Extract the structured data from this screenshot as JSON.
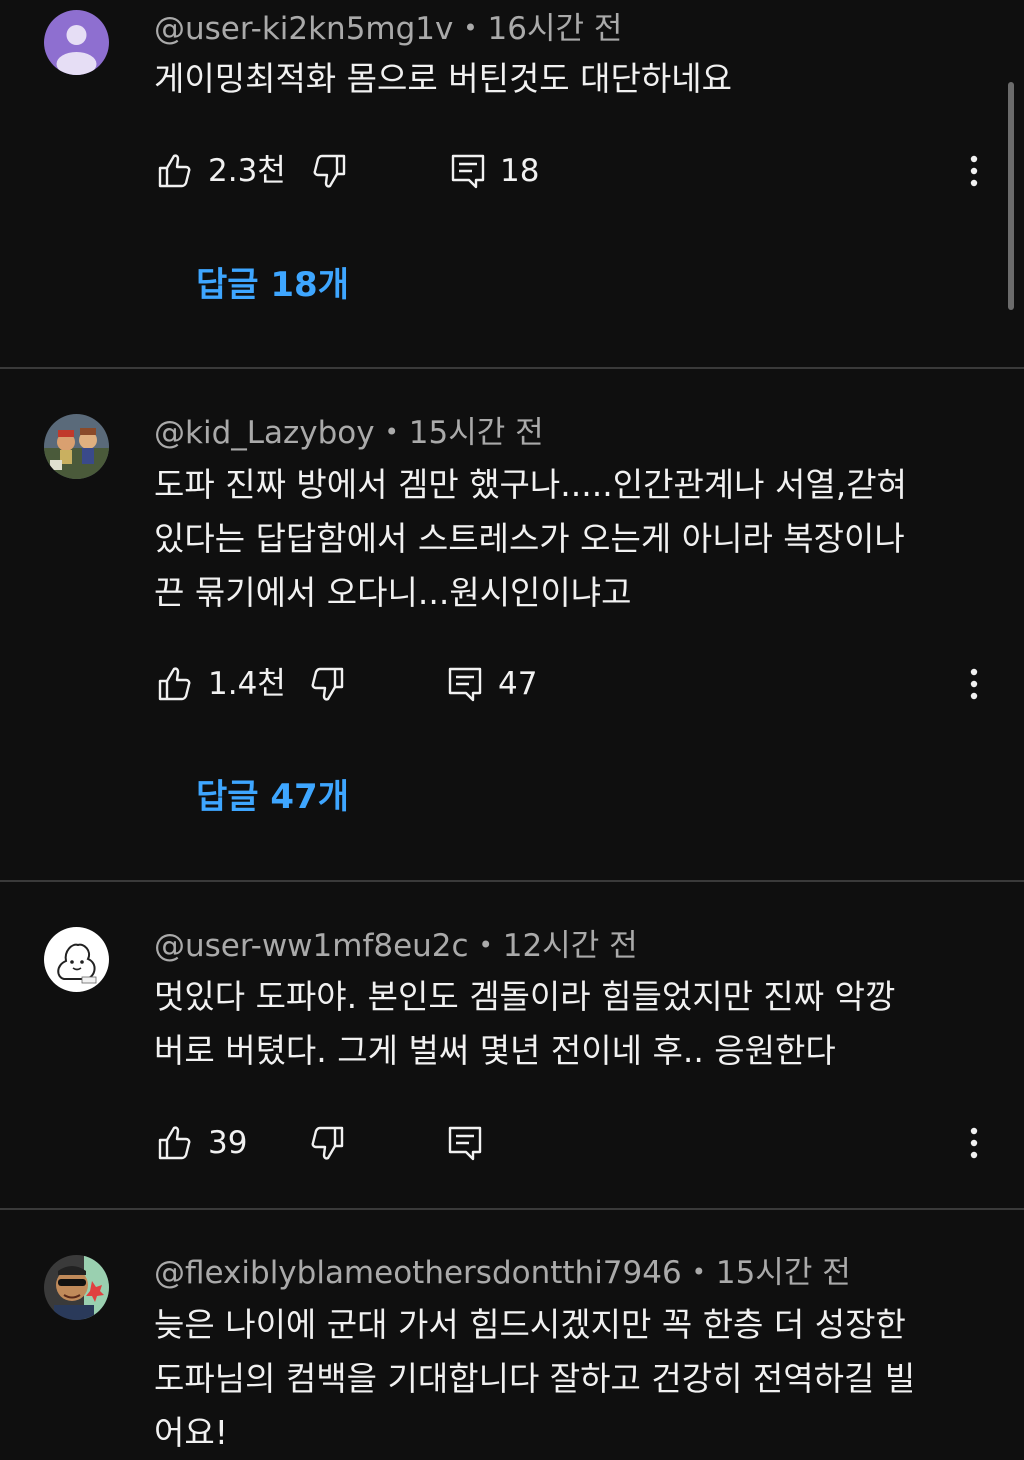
{
  "comments": [
    {
      "author": "@user-ki2kn5mg1v",
      "time": "16시간 전",
      "lines": [
        "게이밍최적화 몸으로 버틴것도 대단하네요"
      ],
      "likes": "2.3천",
      "reply_count": "18",
      "replies_label": "답글 18개"
    },
    {
      "author": "@kid_Lazyboy",
      "time": "15시간 전",
      "lines": [
        "도파 진짜 방에서 겜만 했구나.....인간관계나 서열,갇혀",
        "있다는 답답함에서 스트레스가 오는게 아니라 복장이나",
        "끈 묶기에서 오다니...원시인이냐고"
      ],
      "likes": "1.4천",
      "reply_count": "47",
      "replies_label": "답글 47개"
    },
    {
      "author": "@user-ww1mf8eu2c",
      "time": "12시간 전",
      "lines": [
        "멋있다 도파야. 본인도 겜돌이라 힘들었지만 진짜 악깡",
        "버로 버텼다. 그게 벌써 몇년 전이네 후.. 응원한다"
      ],
      "likes": "39",
      "reply_count": "",
      "replies_label": ""
    },
    {
      "author": "@flexiblyblameothersdontthi7946",
      "time": "15시간 전",
      "lines": [
        "늦은 나이에 군대 가서 힘드시겠지만 꼭 한층 더 성장한",
        "도파님의 컴백을 기대합니다 잘하고 건강히 전역하길 빌",
        "어요!"
      ],
      "likes": "",
      "reply_count": "",
      "replies_label": ""
    }
  ],
  "separator": "•",
  "icons": {
    "like": "thumbs-up-icon",
    "dislike": "thumbs-down-icon",
    "reply": "comment-icon",
    "more": "more-vert-icon"
  },
  "colors": {
    "background": "#0f0f0f",
    "text": "#f1f1f1",
    "secondary": "#aaaaaa",
    "link": "#3ea6ff",
    "divider": "#3a3a3a"
  }
}
